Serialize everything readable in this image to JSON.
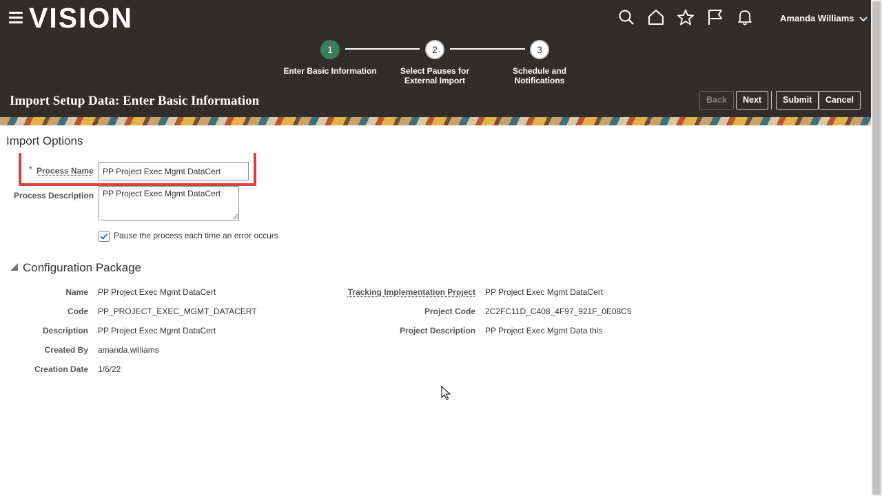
{
  "header": {
    "logo": "VISION",
    "user_name": "Amanda Williams",
    "icons": [
      "search-icon",
      "home-icon",
      "star-icon",
      "flag-icon",
      "bell-icon"
    ]
  },
  "train": {
    "steps": [
      {
        "number": "1",
        "label": "Enter Basic Information",
        "active": true
      },
      {
        "number": "2",
        "label": "Select Pauses for External Import",
        "active": false
      },
      {
        "number": "3",
        "label": "Schedule and Notifications",
        "active": false
      }
    ]
  },
  "page": {
    "title": "Import Setup Data: Enter Basic Information",
    "buttons": {
      "back": "Back",
      "next": "Next",
      "submit": "Submit",
      "cancel": "Cancel"
    }
  },
  "import_options": {
    "section_title": "Import Options",
    "required_mark": "*",
    "process_name_label": "Process Name",
    "process_name_value": "PP Project Exec Mgmt DataCert",
    "process_description_label": "Process Description",
    "process_description_value": "PP Project Exec Mgmt DataCert",
    "pause_checkbox_label": "Pause the process each time an error occurs",
    "pause_checked": true
  },
  "configuration_package": {
    "section_title": "Configuration Package",
    "left": [
      {
        "label": "Name",
        "value": "PP Project Exec Mgmt DataCert"
      },
      {
        "label": "Code",
        "value": "PP_PROJECT_EXEC_MGMT_DATACERT"
      },
      {
        "label": "Description",
        "value": "PP Project Exec Mgmt DataCert"
      },
      {
        "label": "Created By",
        "value": "amanda.williams"
      },
      {
        "label": "Creation Date",
        "value": "1/6/22"
      }
    ],
    "right": [
      {
        "label": "Tracking Implementation Project",
        "value": "PP Project Exec Mgmt DataCert"
      },
      {
        "label": "Project Code",
        "value": "2C2FC11D_C408_4F97_921F_0E08C5"
      },
      {
        "label": "Project Description",
        "value": "PP Project Exec Mgmt Data this"
      }
    ]
  },
  "colors": {
    "header_bg": "#312d2a",
    "active_step": "#3a7f5c",
    "highlight": "#d9403a"
  }
}
